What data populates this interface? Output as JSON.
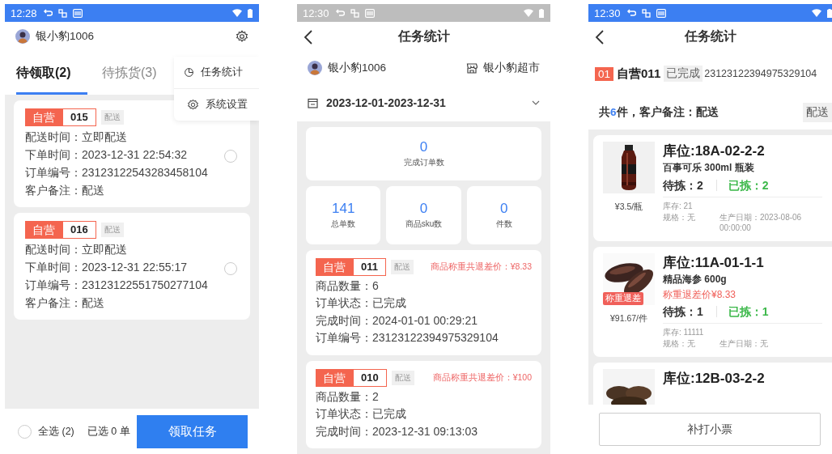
{
  "screens": [
    {
      "kind": "pick_list",
      "status_bar": {
        "time": "12:28",
        "dimmed": false
      },
      "user": "银小豹1006",
      "tabs": [
        {
          "label": "待领取(2)",
          "selected": true
        },
        {
          "label": "待拣货(3)",
          "selected": false
        }
      ],
      "menu": [
        {
          "kind": "stats",
          "label": "任务统计"
        },
        {
          "kind": "settings",
          "label": "系统设置"
        }
      ],
      "orders": [
        {
          "source": "自营",
          "number": "015",
          "type": "配送",
          "lines": [
            "配送时间：立即配送",
            "下单时间：2023-12-31 22:54:32",
            "订单编号：23123122543283458104",
            "客户备注：配送"
          ],
          "selected": false
        },
        {
          "source": "自营",
          "number": "016",
          "type": "配送",
          "lines": [
            "配送时间：立即配送",
            "下单时间：2023-12-31 22:55:17",
            "订单编号：23123122551750277104",
            "客户备注：配送"
          ],
          "selected": false
        }
      ],
      "footer": {
        "select_all": {
          "label": "全选 (2)",
          "checked": false
        },
        "count": "已选 0 单",
        "button": "领取任务"
      }
    },
    {
      "kind": "stats",
      "status_bar": {
        "time": "12:30",
        "dimmed": true
      },
      "title": "任务统计",
      "user": "银小豹1006",
      "store": "银小豹超市",
      "date_range": "2023-12-01-2023-12-31",
      "stats": [
        {
          "value": "0",
          "label": "完成订单数"
        },
        {
          "value": "141",
          "label": "总单数"
        },
        {
          "value": "0",
          "label": "商品sku数"
        },
        {
          "value": "0",
          "label": "件数"
        }
      ],
      "orders": [
        {
          "source": "自营",
          "number": "011",
          "type": "配送",
          "refund": "商品称重共退差价：¥8.33",
          "lines": [
            "商品数量：6",
            "订单状态：已完成",
            "完成时间：2024-01-01 00:29:21",
            "订单编号：23123122394975329104"
          ]
        },
        {
          "source": "自营",
          "number": "010",
          "type": "配送",
          "refund": "商品称重共退差价：¥100",
          "lines": [
            "商品数量：2",
            "订单状态：已完成",
            "完成时间：2023-12-31 09:13:03"
          ]
        }
      ]
    },
    {
      "kind": "order_detail",
      "status_bar": {
        "time": "12:30",
        "dimmed": false
      },
      "title": "任务统计",
      "order": {
        "index": "01",
        "name": "自营011",
        "status": "已完成",
        "number": "23123122394975329104"
      },
      "summary": {
        "before": "共",
        "count": "6",
        "after": "件，客户备注：配送",
        "tag": "配送"
      },
      "items": [
        {
          "location": "库位:18A-02-2-2",
          "name": "百事可乐 300ml 瓶装",
          "price": "¥3.5/瓶",
          "to_pick": "待拣：2",
          "picked": "已拣：2",
          "stock": "库存: 21",
          "spec": "规格：无",
          "production_date": "生产日期：2023-08-06 00:00:00"
        },
        {
          "location": "库位:11A-01-1-1",
          "name": "精品海参 600g",
          "badge": "称重退差",
          "refund": "称重退差价¥8.33",
          "price": "¥91.67/件",
          "to_pick": "待拣：1",
          "picked": "已拣：1",
          "stock": "库存: 11111",
          "spec": "规格：无",
          "production_date": "生产日期：无"
        },
        {
          "location": "库位:12B-03-2-2"
        }
      ],
      "footer_button": "补打小票"
    }
  ]
}
